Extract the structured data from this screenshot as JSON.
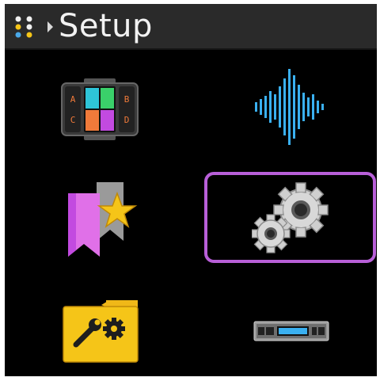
{
  "header": {
    "title": "Setup",
    "app_icon": "grid-dots-icon",
    "breadcrumb_icon": "chevron-right-icon"
  },
  "menu": {
    "items": [
      {
        "id": "scenes",
        "icon": "pad-controller-icon",
        "letters": [
          "A",
          "B",
          "C",
          "D"
        ]
      },
      {
        "id": "audio",
        "icon": "waveform-icon"
      },
      {
        "id": "favorites",
        "icon": "bookmark-star-icon"
      },
      {
        "id": "settings",
        "icon": "gears-icon",
        "selected": true
      },
      {
        "id": "tools",
        "icon": "folder-tools-icon"
      },
      {
        "id": "device",
        "icon": "rack-unit-icon"
      }
    ]
  },
  "colors": {
    "selection": "#b85fd8",
    "header_bg": "#2a2a2a",
    "screen_bg": "#000000",
    "waveform": "#3ab0f0",
    "folder": "#f0b818"
  }
}
